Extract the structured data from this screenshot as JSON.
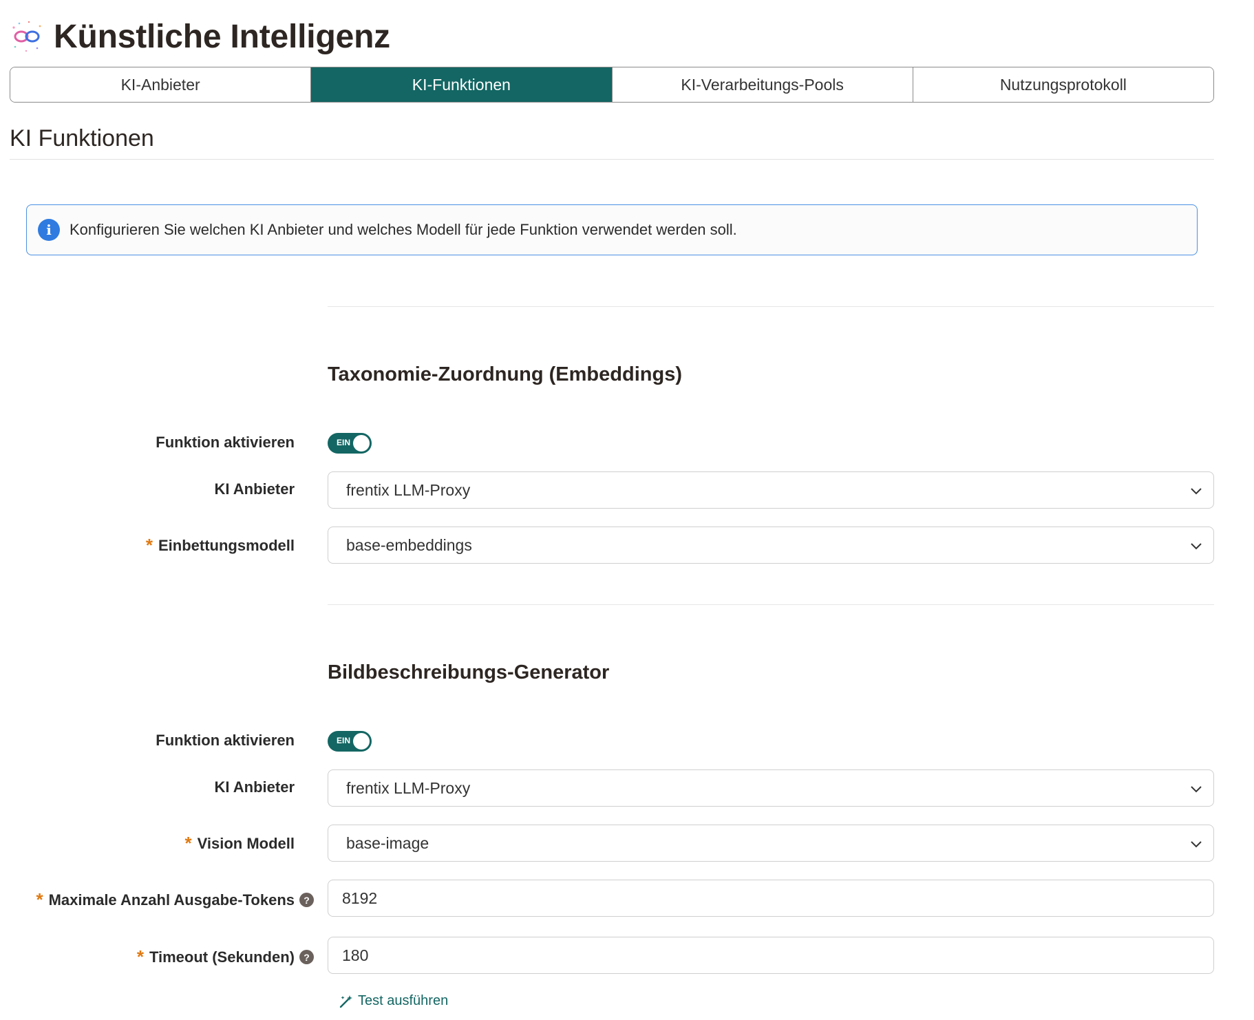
{
  "header": {
    "title": "Künstliche Intelligenz",
    "logo_icon": "ai-infinity-icon"
  },
  "tabs": [
    {
      "label": "KI-Anbieter",
      "active": false
    },
    {
      "label": "KI-Funktionen",
      "active": true
    },
    {
      "label": "KI-Verarbeitungs-Pools",
      "active": false
    },
    {
      "label": "Nutzungsprotokoll",
      "active": false
    }
  ],
  "section": {
    "title": "KI Funktionen"
  },
  "info": {
    "text": "Konfigurieren Sie welchen KI Anbieter und welches Modell für jede Funktion verwendet werden soll.",
    "icon": "info-icon"
  },
  "features": [
    {
      "title": "Taxonomie-Zuordnung (Embeddings)",
      "toggle_label": "Funktion aktivieren",
      "toggle_state": "EIN",
      "provider_label": "KI Anbieter",
      "provider_value": "frentix LLM-Proxy",
      "model_label": "Einbettungsmodell",
      "model_value": "base-embeddings"
    },
    {
      "title": "Bildbeschreibungs-Generator",
      "toggle_label": "Funktion aktivieren",
      "toggle_state": "EIN",
      "provider_label": "KI Anbieter",
      "provider_value": "frentix LLM-Proxy",
      "model_label": "Vision Modell",
      "model_value": "base-image",
      "tokens_label": "Maximale Anzahl Ausgabe-Tokens",
      "tokens_value": "8192",
      "timeout_label": "Timeout (Sekunden)",
      "timeout_value": "180",
      "test_label": "Test ausführen"
    }
  ],
  "colors": {
    "accent": "#136663",
    "required": "#e07a12",
    "info_border": "#4a90e2"
  }
}
